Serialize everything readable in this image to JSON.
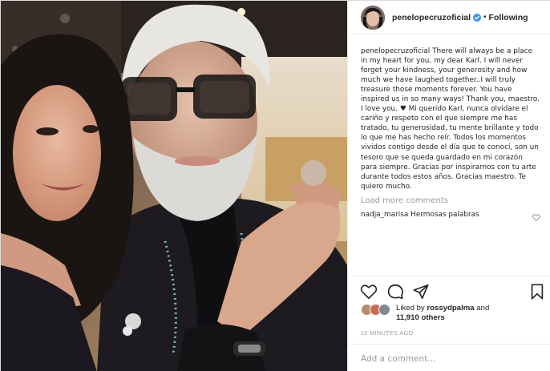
{
  "post": {
    "username": "penelopecruzoficial",
    "follow_separator": "•",
    "follow_label": "Following",
    "verified_icon": "verified-badge-icon",
    "caption_user": "penelopecruzoficial",
    "caption_text": "There will always be a place in my heart for you, my dear Karl. I will never forget your kindness, your generosity and how much we have laughed together..I will truly treasure those moments forever. You have inspired us in so many ways! Thank you, maestro. I love you. ♥ Mi querido Karl, nunca olvidare el cariño y respeto con el que siempre me has tratado, tu generosidad, tu mente brillante y todo lo que me has hecho reír. Todos los momentos vividos contigo desde el día que te conocí, son un tesoro que se queda guardado en mi corazón para siempre. Gracias por inspirarnos con tu arte durante todos estos años. Gracias maestro. Te quiero mucho.",
    "load_more_label": "Load more comments",
    "comment": {
      "user": "nadja_marisa",
      "text": "Hermosas palabras"
    },
    "likes_prefix": "Liked by",
    "likes_user": "rossydpalma",
    "likes_and": "and",
    "likes_count": "11,910 others",
    "timestamp": "10 MINUTES AGO",
    "add_comment_placeholder": "Add a comment..."
  },
  "colors": {
    "text": "#262626",
    "muted": "#999999",
    "verified": "#3897f0",
    "border": "#efefef"
  },
  "icons": [
    "heart-icon",
    "comment-icon",
    "share-icon",
    "bookmark-icon",
    "verified-badge-icon"
  ]
}
